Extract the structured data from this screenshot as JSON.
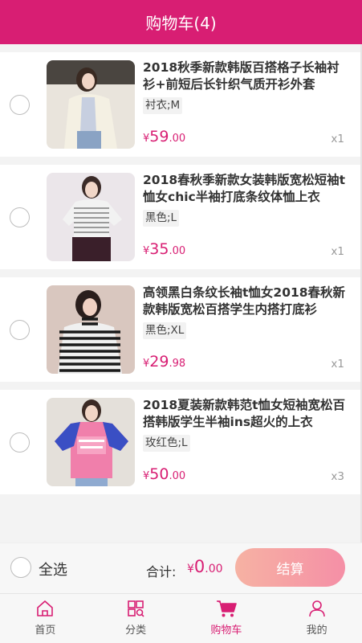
{
  "header": {
    "title": "购物车(4)"
  },
  "items": [
    {
      "title": "2018秋季新款韩版百搭格子长袖衬衫+前短后长针织气质开衫外套",
      "spec": "衬衣;M",
      "price_symbol": "¥",
      "price_int": "59",
      "price_dec": ".00",
      "qty": "x1"
    },
    {
      "title": "2018春秋季新款女装韩版宽松短袖t恤女chic半袖打底条纹体恤上衣",
      "spec": "黑色;L",
      "price_symbol": "¥",
      "price_int": "35",
      "price_dec": ".00",
      "qty": "x1"
    },
    {
      "title": "高领黑白条纹长袖t恤女2018春秋新款韩版宽松百搭学生内搭打底衫",
      "spec": "黑色;XL",
      "price_symbol": "¥",
      "price_int": "29",
      "price_dec": ".98",
      "qty": "x1"
    },
    {
      "title": "2018夏装新款韩范t恤女短袖宽松百搭韩版学生半袖ins超火的上衣",
      "spec": "玫红色;L",
      "price_symbol": "¥",
      "price_int": "50",
      "price_dec": ".00",
      "qty": "x3"
    }
  ],
  "checkout": {
    "select_all": "全选",
    "total_label": "合计:",
    "total_symbol": "¥",
    "total_int": "0",
    "total_dec": ".00",
    "settle": "结算"
  },
  "tabs": [
    {
      "label": "首页",
      "icon": "home-icon"
    },
    {
      "label": "分类",
      "icon": "category-icon"
    },
    {
      "label": "购物车",
      "icon": "cart-icon",
      "active": true
    },
    {
      "label": "我的",
      "icon": "user-icon"
    }
  ],
  "colors": {
    "accent": "#d81e73",
    "button_start": "#f6b2a3",
    "button_end": "#f58fa6"
  }
}
